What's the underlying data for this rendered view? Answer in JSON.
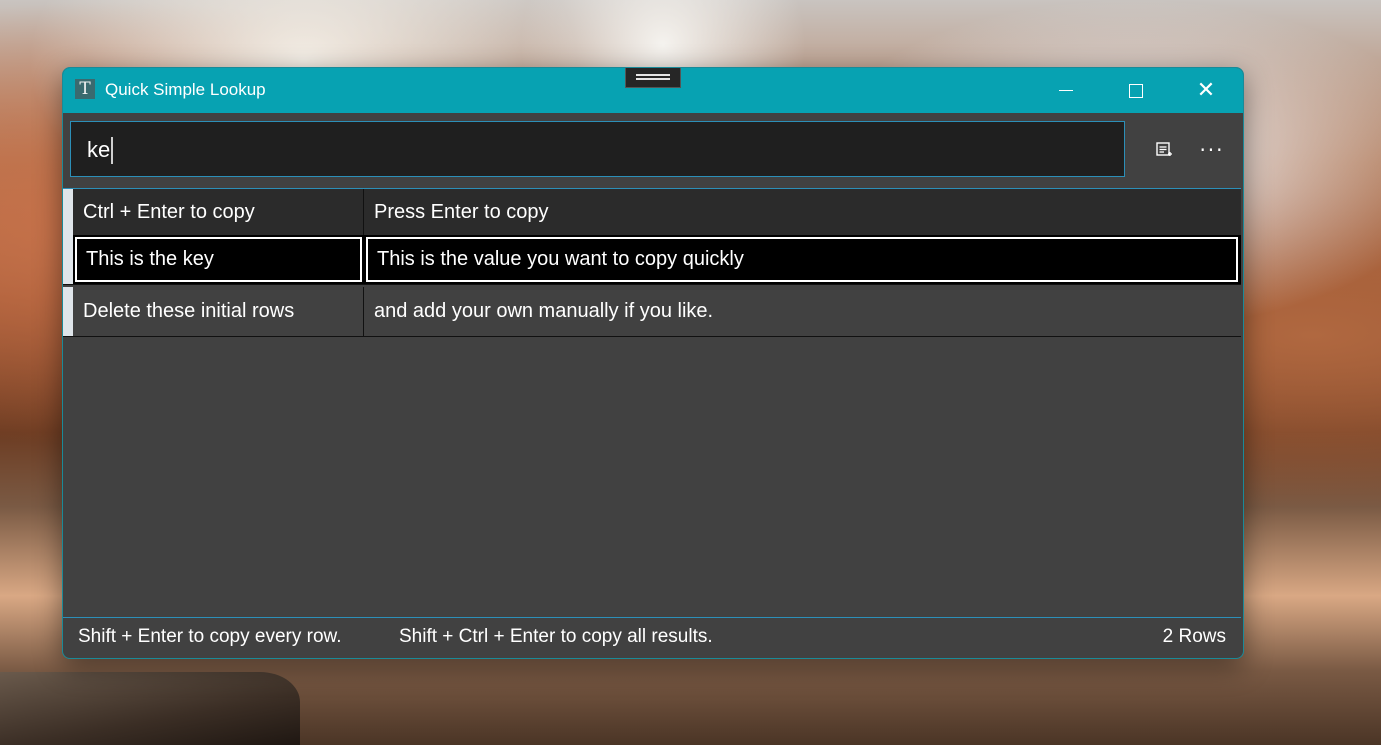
{
  "window": {
    "title": "Quick Simple Lookup",
    "icon_glyph": "T",
    "icon": "app-t-icon",
    "controls": {
      "minimize_icon": "minimize-icon",
      "maximize_icon": "maximize-icon",
      "close_icon": "close-icon",
      "close_glyph": "✕"
    },
    "accent_color": "#07a2b2"
  },
  "search": {
    "value": "ke",
    "actions": [
      {
        "icon": "notes-icon",
        "glyph": "☰"
      },
      {
        "icon": "more-icon",
        "glyph": "···"
      }
    ]
  },
  "table": {
    "header": {
      "key": "Ctrl + Enter to copy",
      "value": "Press Enter to copy"
    },
    "rows": [
      {
        "key": "This is the key",
        "value": "This is the value you want to copy quickly",
        "selected": true
      },
      {
        "key": "Delete these initial rows",
        "value": "and add your own manually if you like.",
        "selected": false
      }
    ]
  },
  "status": {
    "hint_all": "Shift + Enter to copy every row.",
    "hint_results": "Shift + Ctrl + Enter to copy all results.",
    "row_count": "2 Rows"
  }
}
